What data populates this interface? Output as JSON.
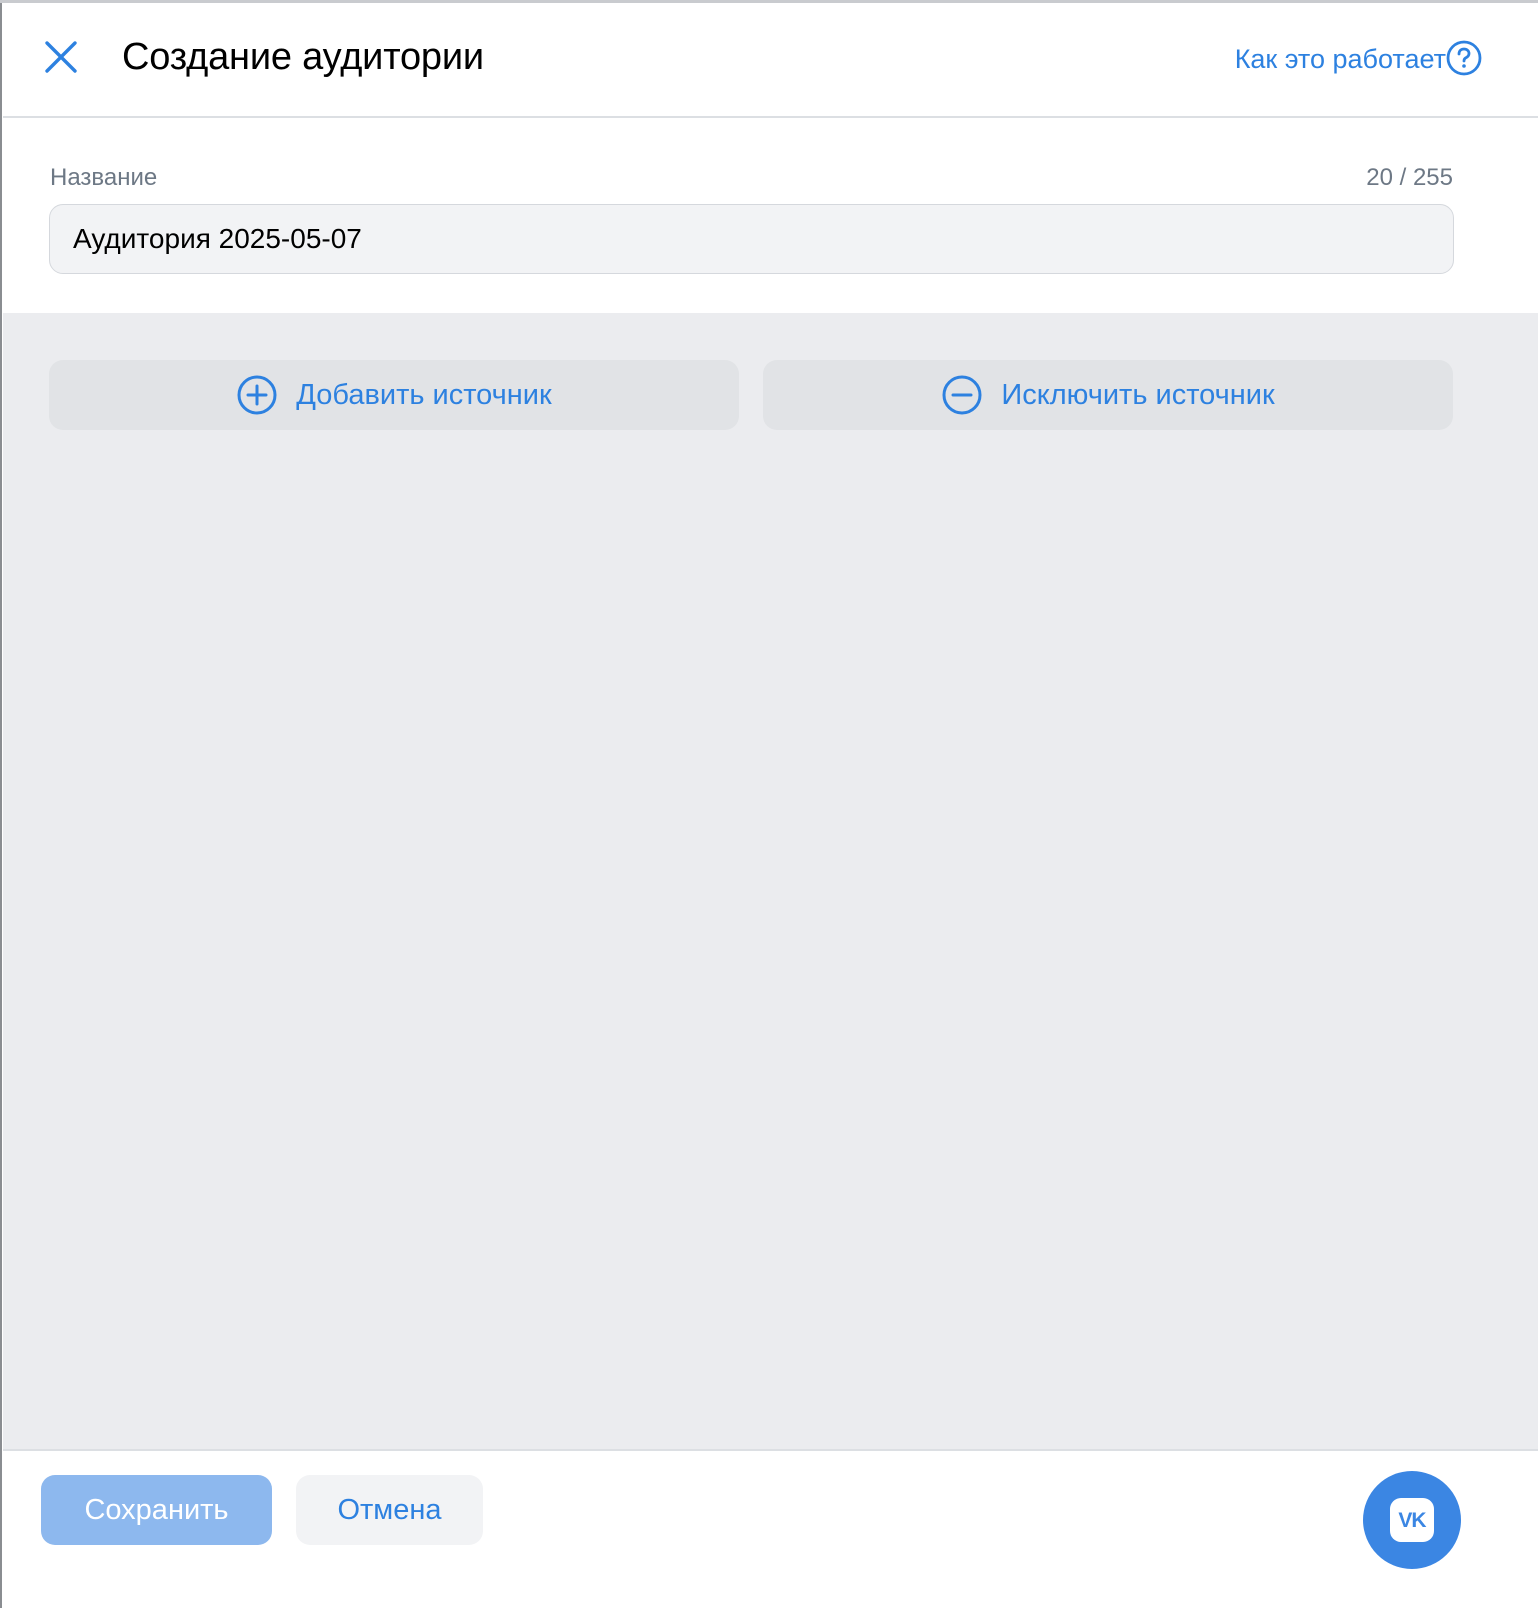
{
  "header": {
    "title": "Создание аудитории",
    "help_link_label": "Как это работает"
  },
  "name_field": {
    "label": "Название",
    "counter": "20 / 255",
    "value": "Аудитория 2025-05-07"
  },
  "sources": {
    "add_label": "Добавить источник",
    "exclude_label": "Исключить источник"
  },
  "footer": {
    "save_label": "Сохранить",
    "cancel_label": "Отмена",
    "fab_logo_text": "VK"
  },
  "icons": {
    "close": "close-icon",
    "help": "help-circle-icon",
    "add": "plus-circle-icon",
    "exclude": "minus-circle-icon",
    "vk": "vk-logo-icon"
  },
  "colors": {
    "accent": "#2d81e0",
    "content_background": "#ebecef",
    "button_secondary": "#e1e3e6",
    "save_disabled": "#8db8ee",
    "vk_blue": "#3b86e3"
  }
}
